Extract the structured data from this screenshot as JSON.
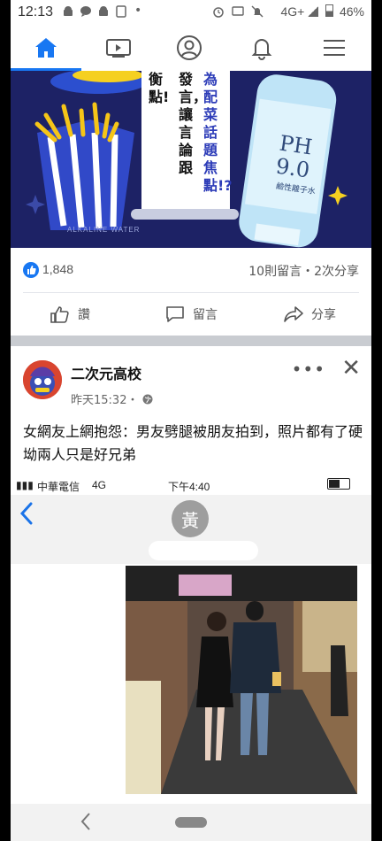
{
  "status_bar": {
    "time": "12:13",
    "network": "4G+",
    "battery": "46%"
  },
  "nav": {
    "tabs": [
      {
        "name": "home-icon",
        "active": true
      },
      {
        "name": "video-icon",
        "active": false
      },
      {
        "name": "profile-icon",
        "active": false
      },
      {
        "name": "bell-icon",
        "active": false
      },
      {
        "name": "menu-icon",
        "active": false
      }
    ],
    "accent": "#1877f2"
  },
  "banner": {
    "vertical_text_1": "為配菜話題焦點!?",
    "vertical_text_2": "發言，讓言論跟",
    "vertical_text_3": "衡點!",
    "bottle_brand": "PH",
    "bottle_value": "9.0",
    "bottle_sub": "鹼性離子水",
    "caption": "ALKALINE WATER"
  },
  "previous_post": {
    "like_count": "1,848",
    "meta": "10則留言・2次分享",
    "actions": {
      "like": "讚",
      "comment": "留言",
      "share": "分享"
    }
  },
  "post": {
    "page_name": "二次元高校",
    "timestamp": "昨天15:32・",
    "text": "女網友上網抱怨：男友劈腿被朋友拍到，照片都有了硬坳兩人只是好兄弟",
    "screenshot": {
      "carrier": "中華電信",
      "network": "4G",
      "time": "下午4:40",
      "contact_initial": "黃"
    }
  }
}
